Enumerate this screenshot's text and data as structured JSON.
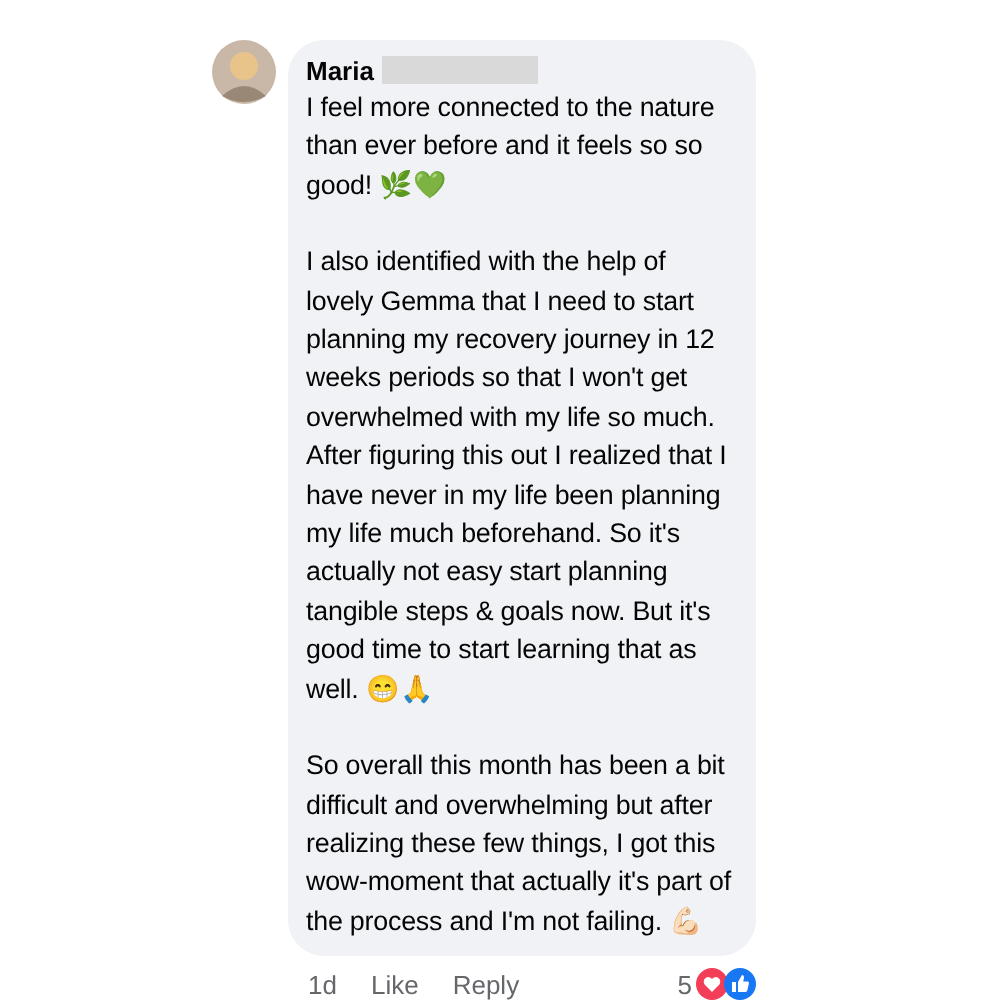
{
  "comment": {
    "author": "Maria",
    "paragraphs": [
      "I feel more connected to the nature than ever before and it feels so so good! 🌿💚",
      "I also identified with the help of lovely Gemma that I need to start planning my recovery journey in 12 weeks periods so that I won't get overwhelmed with my life so much. After figuring this out I realized that I have never in my life been planning my life much beforehand. So it's actually not easy start planning tangible steps & goals now. But it's good time to start learning that as well. 😁🙏",
      "So overall this month has been a bit difficult and overwhelming but after realizing these few things, I got this wow-moment that actually it's part of the process and I'm not failing. 💪🏻"
    ]
  },
  "footer": {
    "time": "1d",
    "actions": [
      "Like",
      "Reply"
    ],
    "reaction_count": "5"
  }
}
